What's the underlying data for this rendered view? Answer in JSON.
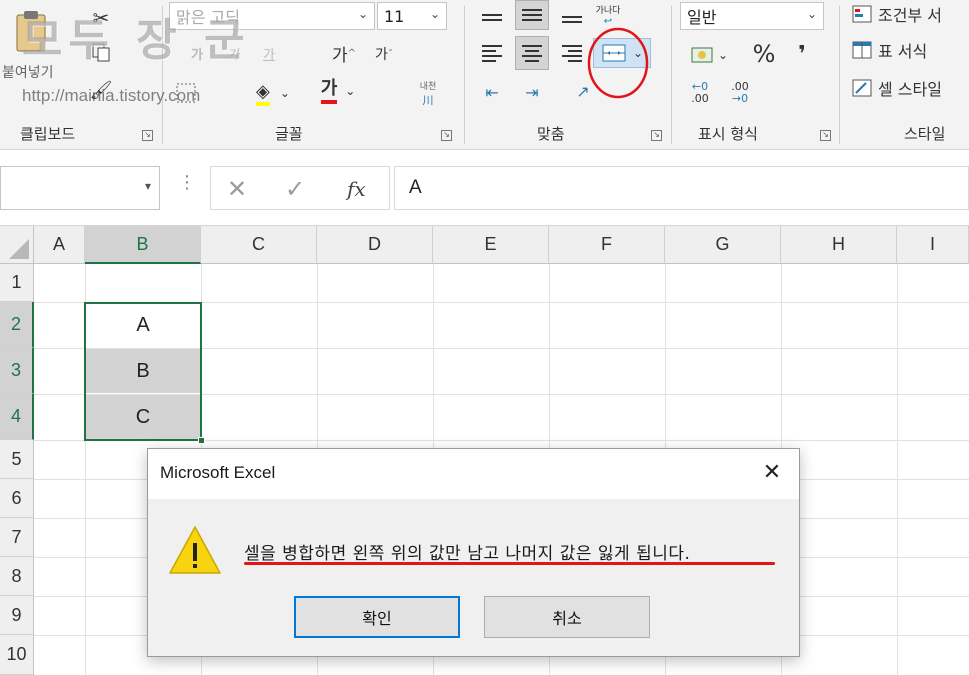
{
  "ribbon": {
    "watermark_text": "모두 장 군",
    "watermark_url": "http://mainia.tistory.com",
    "paste_label": "붙여넣기",
    "font_name": "맑은 고딕",
    "font_size": "11",
    "font_grow": "가",
    "font_shrink": "가",
    "font_color_glyph": "가",
    "phonetic_label": "내천",
    "wrap_label": "가나다",
    "number_format": "일반",
    "percent": "%",
    "comma": "❜",
    "dec_inc": ".00",
    "dec_dec": ".00",
    "style_conditional": "조건부 서",
    "style_table": "표 서식",
    "style_cell": "셀 스타일",
    "groups": {
      "clipboard": "클립보드",
      "font": "글꼴",
      "alignment": "맞춤",
      "number": "표시 형식",
      "styles": "스타일"
    },
    "merge_highlight_color": "#e2151b"
  },
  "formula_bar": {
    "name_box": "",
    "cancel": "✕",
    "enter": "✓",
    "fx": "fx",
    "content": "A"
  },
  "grid": {
    "columns": [
      "A",
      "B",
      "C",
      "D",
      "E",
      "F",
      "G",
      "H",
      "I"
    ],
    "rows": [
      "1",
      "2",
      "3",
      "4",
      "5",
      "6",
      "7",
      "8",
      "9",
      "10"
    ],
    "cells": {
      "B2": "A",
      "B3": "B",
      "B4": "C"
    },
    "accent": "#217346"
  },
  "dialog": {
    "title": "Microsoft Excel",
    "message": "셀을 병합하면 왼쪽 위의 값만 남고 나머지 값은 잃게 됩니다.",
    "ok_label": "확인",
    "cancel_label": "취소",
    "icon": "warning-icon"
  }
}
